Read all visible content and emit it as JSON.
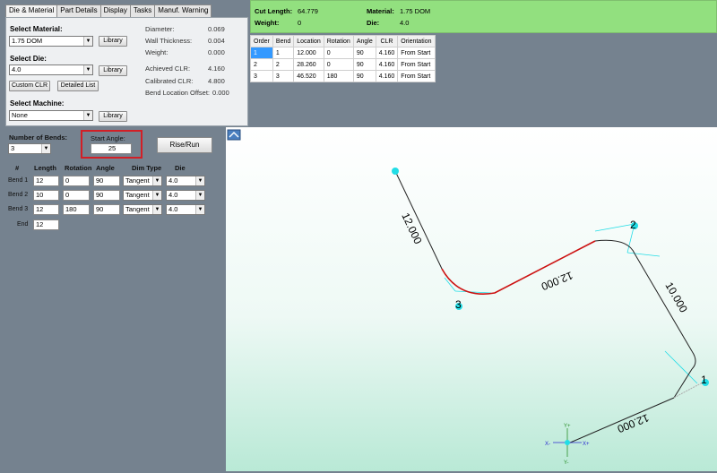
{
  "tabs": [
    "Die & Material",
    "Part Details",
    "Display",
    "Tasks",
    "Manuf. Warning"
  ],
  "material": {
    "select_material_label": "Select Material:",
    "material_value": "1.75 DOM",
    "library_label": "Library",
    "select_die_label": "Select Die:",
    "die_value": "4.0",
    "custom_clr_label": "Custom CLR",
    "detailed_list_label": "Detailed List",
    "select_machine_label": "Select Machine:",
    "machine_value": "None",
    "props": [
      {
        "label": "Diameter:",
        "value": "0.069"
      },
      {
        "label": "Wall Thickness:",
        "value": "0.004"
      },
      {
        "label": "Weight:",
        "value": "0.000"
      },
      {
        "label": "Achieved CLR:",
        "value": "4.160"
      },
      {
        "label": "Calibrated CLR:",
        "value": "4.800"
      },
      {
        "label": "Bend Location Offset:",
        "value": "0.000"
      }
    ]
  },
  "summary": {
    "cut_length_label": "Cut Length:",
    "cut_length_value": "64.779",
    "weight_label": "Weight:",
    "weight_value": "0",
    "material_label": "Material:",
    "material_value": "1.75 DOM",
    "die_label": "Die:",
    "die_value": "4.0"
  },
  "bend_table": {
    "headers": [
      "Order",
      "Bend",
      "Location",
      "Rotation",
      "Angle",
      "CLR",
      "Orientation"
    ],
    "rows": [
      [
        "1",
        "1",
        "12.000",
        "0",
        "90",
        "4.160",
        "From Start"
      ],
      [
        "2",
        "2",
        "28.260",
        "0",
        "90",
        "4.160",
        "From Start"
      ],
      [
        "3",
        "3",
        "46.520",
        "180",
        "90",
        "4.160",
        "From Start"
      ]
    ]
  },
  "bends_panel": {
    "number_of_bends_label": "Number of Bends:",
    "number_of_bends_value": "3",
    "start_angle_label": "Start Angle:",
    "start_angle_value": "25",
    "rise_run_label": "Rise/Run",
    "col_headers": [
      "#",
      "Length",
      "Rotation",
      "Angle",
      "Dim Type",
      "Die"
    ],
    "rows": [
      {
        "label": "Bend 1",
        "length": "12",
        "rotation": "0",
        "angle": "90",
        "dim_type": "Tangent",
        "die": "4.0"
      },
      {
        "label": "Bend 2",
        "length": "10",
        "rotation": "0",
        "angle": "90",
        "dim_type": "Tangent",
        "die": "4.0"
      },
      {
        "label": "Bend 3",
        "length": "12",
        "rotation": "180",
        "angle": "90",
        "dim_type": "Tangent",
        "die": "4.0"
      }
    ],
    "end_label": "End",
    "end_value": "12"
  },
  "canvas": {
    "dim_labels": [
      "12.000",
      "12.000",
      "10.000",
      "12.000"
    ],
    "node_labels": [
      "1",
      "2",
      "3"
    ],
    "axis_labels": {
      "y_plus": "Y+",
      "y_minus": "Y-",
      "x_plus": "X+",
      "x_minus": "X-"
    },
    "highlight_color": "#cc1111",
    "node_color": "#22dde6",
    "accent_red": "#d21f26"
  }
}
